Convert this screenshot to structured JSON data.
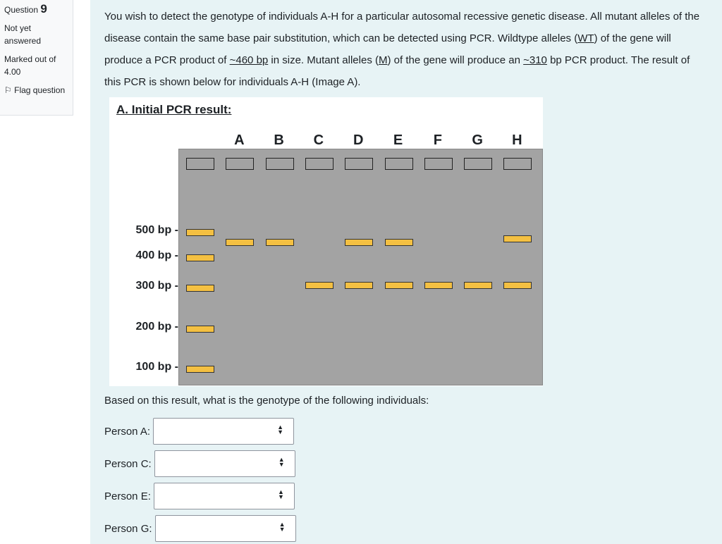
{
  "info": {
    "question_label": "Question",
    "question_number": "9",
    "status": "Not yet answered",
    "marked": "Marked out of 4.00",
    "flag": "Flag question"
  },
  "question": {
    "p1": "You wish to detect the genotype of individuals  A-H for a particular autosomal recessive genetic disease. All mutant alleles of the disease contain the same base pair substitution, which can be detected using PCR. Wildtype alleles (",
    "wt": "WT",
    "p2": ") of the gene will produce a PCR product of ",
    "wtsize": "~460 bp",
    "p3": " in size. Mutant alleles (",
    "m": "M",
    "p4": ") of the gene will produce an ",
    "msize": "~310",
    "p5": " bp PCR product. The result of this PCR is shown below for individuals A-H (Image A)."
  },
  "figure": {
    "title": "A. Initial PCR result:",
    "lanes": [
      "A",
      "B",
      "C",
      "D",
      "E",
      "F",
      "G",
      "H"
    ],
    "ladder": [
      "500 bp -",
      "400 bp -",
      "300 bp -",
      "200 bp -",
      "100 bp -"
    ],
    "bands": {
      "A": [
        "~460"
      ],
      "B": [
        "~460"
      ],
      "C": [
        "~310"
      ],
      "D": [
        "~460",
        "~310"
      ],
      "E": [
        "~460",
        "~310"
      ],
      "F": [
        "~310"
      ],
      "G": [
        "~310"
      ],
      "H": [
        "~460",
        "~310"
      ]
    }
  },
  "prompt": "Based on this result, what is the genotype of the following individuals:",
  "persons": [
    {
      "label": "Person A:",
      "value": ""
    },
    {
      "label": "Person C:",
      "value": ""
    },
    {
      "label": "Person E:",
      "value": ""
    },
    {
      "label": "Person G:",
      "value": ""
    }
  ],
  "colors": {
    "band": "#f4c042",
    "gel": "#a3a3a3",
    "background": "#e7f3f5"
  }
}
